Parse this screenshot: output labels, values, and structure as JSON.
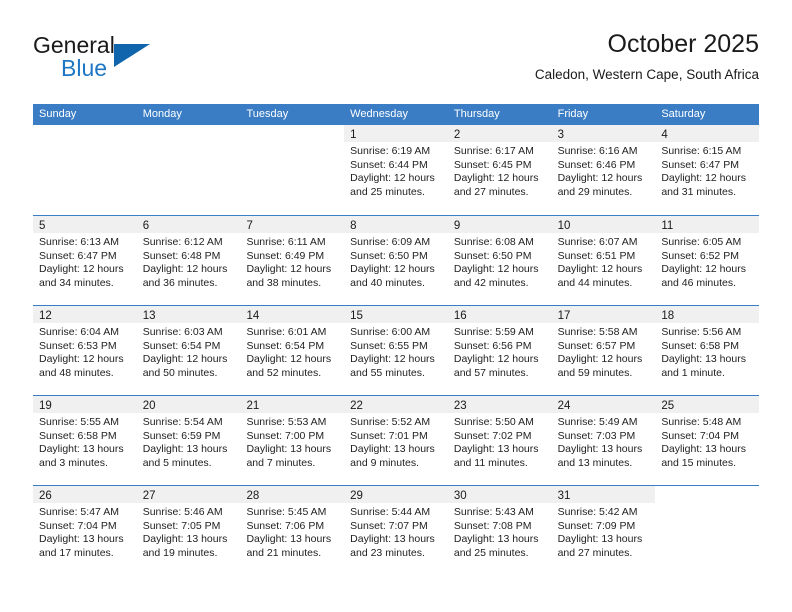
{
  "brand": {
    "name_top": "General",
    "name_bottom": "Blue",
    "triangle_color": "#1065ad",
    "blue_color": "#1f77c4"
  },
  "header": {
    "title": "October 2025",
    "subtitle": "Caledon, Western Cape, South Africa"
  },
  "theme": {
    "header_band": "#3a7dc4",
    "day_band": "#f0f0f0",
    "text": "#1a1a1a"
  },
  "weekdays": [
    "Sunday",
    "Monday",
    "Tuesday",
    "Wednesday",
    "Thursday",
    "Friday",
    "Saturday"
  ],
  "weeks": [
    [
      {
        "date": "",
        "blank": true,
        "sunrise": "",
        "sunset": "",
        "daylight1": "",
        "daylight2": ""
      },
      {
        "date": "",
        "blank": true,
        "sunrise": "",
        "sunset": "",
        "daylight1": "",
        "daylight2": ""
      },
      {
        "date": "",
        "blank": true,
        "sunrise": "",
        "sunset": "",
        "daylight1": "",
        "daylight2": ""
      },
      {
        "date": "1",
        "sunrise": "Sunrise: 6:19 AM",
        "sunset": "Sunset: 6:44 PM",
        "daylight1": "Daylight: 12 hours",
        "daylight2": "and 25 minutes."
      },
      {
        "date": "2",
        "sunrise": "Sunrise: 6:17 AM",
        "sunset": "Sunset: 6:45 PM",
        "daylight1": "Daylight: 12 hours",
        "daylight2": "and 27 minutes."
      },
      {
        "date": "3",
        "sunrise": "Sunrise: 6:16 AM",
        "sunset": "Sunset: 6:46 PM",
        "daylight1": "Daylight: 12 hours",
        "daylight2": "and 29 minutes."
      },
      {
        "date": "4",
        "sunrise": "Sunrise: 6:15 AM",
        "sunset": "Sunset: 6:47 PM",
        "daylight1": "Daylight: 12 hours",
        "daylight2": "and 31 minutes."
      }
    ],
    [
      {
        "date": "5",
        "sunrise": "Sunrise: 6:13 AM",
        "sunset": "Sunset: 6:47 PM",
        "daylight1": "Daylight: 12 hours",
        "daylight2": "and 34 minutes."
      },
      {
        "date": "6",
        "sunrise": "Sunrise: 6:12 AM",
        "sunset": "Sunset: 6:48 PM",
        "daylight1": "Daylight: 12 hours",
        "daylight2": "and 36 minutes."
      },
      {
        "date": "7",
        "sunrise": "Sunrise: 6:11 AM",
        "sunset": "Sunset: 6:49 PM",
        "daylight1": "Daylight: 12 hours",
        "daylight2": "and 38 minutes."
      },
      {
        "date": "8",
        "sunrise": "Sunrise: 6:09 AM",
        "sunset": "Sunset: 6:50 PM",
        "daylight1": "Daylight: 12 hours",
        "daylight2": "and 40 minutes."
      },
      {
        "date": "9",
        "sunrise": "Sunrise: 6:08 AM",
        "sunset": "Sunset: 6:50 PM",
        "daylight1": "Daylight: 12 hours",
        "daylight2": "and 42 minutes."
      },
      {
        "date": "10",
        "sunrise": "Sunrise: 6:07 AM",
        "sunset": "Sunset: 6:51 PM",
        "daylight1": "Daylight: 12 hours",
        "daylight2": "and 44 minutes."
      },
      {
        "date": "11",
        "sunrise": "Sunrise: 6:05 AM",
        "sunset": "Sunset: 6:52 PM",
        "daylight1": "Daylight: 12 hours",
        "daylight2": "and 46 minutes."
      }
    ],
    [
      {
        "date": "12",
        "sunrise": "Sunrise: 6:04 AM",
        "sunset": "Sunset: 6:53 PM",
        "daylight1": "Daylight: 12 hours",
        "daylight2": "and 48 minutes."
      },
      {
        "date": "13",
        "sunrise": "Sunrise: 6:03 AM",
        "sunset": "Sunset: 6:54 PM",
        "daylight1": "Daylight: 12 hours",
        "daylight2": "and 50 minutes."
      },
      {
        "date": "14",
        "sunrise": "Sunrise: 6:01 AM",
        "sunset": "Sunset: 6:54 PM",
        "daylight1": "Daylight: 12 hours",
        "daylight2": "and 52 minutes."
      },
      {
        "date": "15",
        "sunrise": "Sunrise: 6:00 AM",
        "sunset": "Sunset: 6:55 PM",
        "daylight1": "Daylight: 12 hours",
        "daylight2": "and 55 minutes."
      },
      {
        "date": "16",
        "sunrise": "Sunrise: 5:59 AM",
        "sunset": "Sunset: 6:56 PM",
        "daylight1": "Daylight: 12 hours",
        "daylight2": "and 57 minutes."
      },
      {
        "date": "17",
        "sunrise": "Sunrise: 5:58 AM",
        "sunset": "Sunset: 6:57 PM",
        "daylight1": "Daylight: 12 hours",
        "daylight2": "and 59 minutes."
      },
      {
        "date": "18",
        "sunrise": "Sunrise: 5:56 AM",
        "sunset": "Sunset: 6:58 PM",
        "daylight1": "Daylight: 13 hours",
        "daylight2": "and 1 minute."
      }
    ],
    [
      {
        "date": "19",
        "sunrise": "Sunrise: 5:55 AM",
        "sunset": "Sunset: 6:58 PM",
        "daylight1": "Daylight: 13 hours",
        "daylight2": "and 3 minutes."
      },
      {
        "date": "20",
        "sunrise": "Sunrise: 5:54 AM",
        "sunset": "Sunset: 6:59 PM",
        "daylight1": "Daylight: 13 hours",
        "daylight2": "and 5 minutes."
      },
      {
        "date": "21",
        "sunrise": "Sunrise: 5:53 AM",
        "sunset": "Sunset: 7:00 PM",
        "daylight1": "Daylight: 13 hours",
        "daylight2": "and 7 minutes."
      },
      {
        "date": "22",
        "sunrise": "Sunrise: 5:52 AM",
        "sunset": "Sunset: 7:01 PM",
        "daylight1": "Daylight: 13 hours",
        "daylight2": "and 9 minutes."
      },
      {
        "date": "23",
        "sunrise": "Sunrise: 5:50 AM",
        "sunset": "Sunset: 7:02 PM",
        "daylight1": "Daylight: 13 hours",
        "daylight2": "and 11 minutes."
      },
      {
        "date": "24",
        "sunrise": "Sunrise: 5:49 AM",
        "sunset": "Sunset: 7:03 PM",
        "daylight1": "Daylight: 13 hours",
        "daylight2": "and 13 minutes."
      },
      {
        "date": "25",
        "sunrise": "Sunrise: 5:48 AM",
        "sunset": "Sunset: 7:04 PM",
        "daylight1": "Daylight: 13 hours",
        "daylight2": "and 15 minutes."
      }
    ],
    [
      {
        "date": "26",
        "sunrise": "Sunrise: 5:47 AM",
        "sunset": "Sunset: 7:04 PM",
        "daylight1": "Daylight: 13 hours",
        "daylight2": "and 17 minutes."
      },
      {
        "date": "27",
        "sunrise": "Sunrise: 5:46 AM",
        "sunset": "Sunset: 7:05 PM",
        "daylight1": "Daylight: 13 hours",
        "daylight2": "and 19 minutes."
      },
      {
        "date": "28",
        "sunrise": "Sunrise: 5:45 AM",
        "sunset": "Sunset: 7:06 PM",
        "daylight1": "Daylight: 13 hours",
        "daylight2": "and 21 minutes."
      },
      {
        "date": "29",
        "sunrise": "Sunrise: 5:44 AM",
        "sunset": "Sunset: 7:07 PM",
        "daylight1": "Daylight: 13 hours",
        "daylight2": "and 23 minutes."
      },
      {
        "date": "30",
        "sunrise": "Sunrise: 5:43 AM",
        "sunset": "Sunset: 7:08 PM",
        "daylight1": "Daylight: 13 hours",
        "daylight2": "and 25 minutes."
      },
      {
        "date": "31",
        "sunrise": "Sunrise: 5:42 AM",
        "sunset": "Sunset: 7:09 PM",
        "daylight1": "Daylight: 13 hours",
        "daylight2": "and 27 minutes."
      },
      {
        "date": "",
        "blank": true,
        "sunrise": "",
        "sunset": "",
        "daylight1": "",
        "daylight2": ""
      }
    ]
  ]
}
